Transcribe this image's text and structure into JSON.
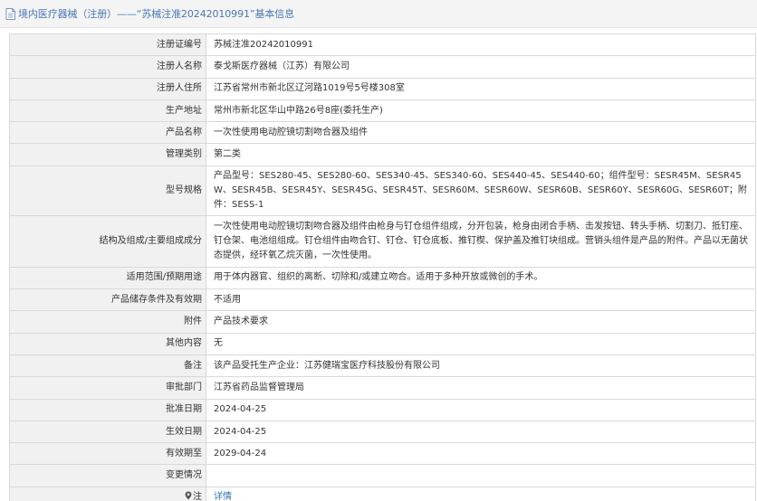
{
  "header": {
    "title": "境内医疗器械（注册）——“苏械注准20242010991”基本信息"
  },
  "rows": [
    {
      "label": "注册证编号",
      "value": "苏械注准20242010991"
    },
    {
      "label": "注册人名称",
      "value": "泰戈斯医疗器械（江苏）有限公司"
    },
    {
      "label": "注册人住所",
      "value": "江苏省常州市新北区辽河路1019号5号楼308室"
    },
    {
      "label": "生产地址",
      "value": "常州市新北区华山中路26号8座(委托生产)"
    },
    {
      "label": "产品名称",
      "value": "一次性使用电动腔镜切割吻合器及组件"
    },
    {
      "label": "管理类别",
      "value": "第二类"
    },
    {
      "label": "型号规格",
      "value": "产品型号：SES280-45、SES280-60、SES340-45、SES340-60、SES440-45、SES440-60；组件型号：SESR45M、SESR45W、SESR45B、SESR45Y、SESR45G、SESR45T、SESR60M、SESR60W、SESR60B、SESR60Y、SESR60G、SESR60T；附件：SESS-1"
    },
    {
      "label": "结构及组成/主要组成成分",
      "value": "一次性使用电动腔镜切割吻合器及组件由枪身与钉仓组件组成，分开包装，枪身由闭合手柄、击发按钮、转头手柄、切割刀、抵钉座、钉仓架、电池组组成。钉仓组件由吻合钉、钉仓、钉仓底板、推钉楔、保护盖及推钉块组成。营销头组件是产品的附件。产品以无菌状态提供，经环氧乙烷灭菌，一次性使用。"
    },
    {
      "label": "适用范围/预期用途",
      "value": "用于体内器官、组织的离断、切除和/或建立吻合。适用于多种开放或微创的手术。"
    },
    {
      "label": "产品储存条件及有效期",
      "value": "不适用"
    },
    {
      "label": "附件",
      "value": "产品技术要求"
    },
    {
      "label": "其他内容",
      "value": "无"
    },
    {
      "label": "备注",
      "value": "该产品受托生产企业：江苏健瑞宝医疗科技股份有限公司"
    },
    {
      "label": "审批部门",
      "value": "江苏省药品监督管理局"
    },
    {
      "label": "批准日期",
      "value": "2024-04-25"
    },
    {
      "label": "生效日期",
      "value": "2024-04-25"
    },
    {
      "label": "有效期至",
      "value": "2029-04-24"
    },
    {
      "label": "变更情况",
      "value": ""
    }
  ],
  "footer_row": {
    "label": "注",
    "link": "详情",
    "icon": "location-pin-icon"
  },
  "colors": {
    "header_text": "#4a78b5",
    "label_bg": "#f1f1f1",
    "border": "#d9d9d9",
    "link": "#2f6fb5"
  }
}
